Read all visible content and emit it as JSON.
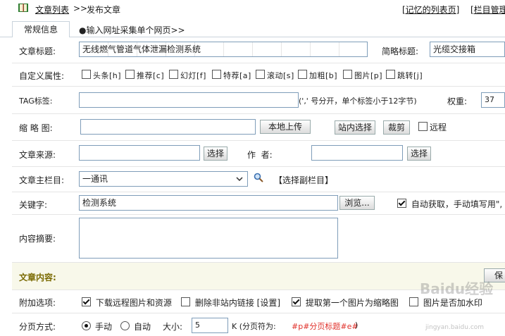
{
  "header": {
    "breadcrumb_link": "文章列表",
    "breadcrumb_sep": ">>",
    "breadcrumb_current": "发布文章",
    "link_saved": "[记忆的列表页]",
    "link_column": "[栏目管理"
  },
  "tabs": {
    "general": "常规信息",
    "url_collect": "●输入网址采集单个网页>>"
  },
  "title_row": {
    "label": "文章标题:",
    "value": "无线燃气管道气体泄漏检测系统",
    "short_label": "简略标题:",
    "short_value": "光缆交接箱"
  },
  "attrs_row": {
    "label": "自定义属性:",
    "items": [
      {
        "label": "头条[h]",
        "checked": false
      },
      {
        "label": "推荐[c]",
        "checked": false
      },
      {
        "label": "幻灯[f]",
        "checked": false
      },
      {
        "label": "特荐[a]",
        "checked": false
      },
      {
        "label": "滚动[s]",
        "checked": false
      },
      {
        "label": "加粗[b]",
        "checked": false
      },
      {
        "label": "图片[p]",
        "checked": false
      },
      {
        "label": "跳转[j]",
        "checked": false
      }
    ]
  },
  "tag_row": {
    "label": "TAG标签:",
    "value": "",
    "hint": "(',' 号分开，单个标签小于12字节)",
    "weight_label": "权重:",
    "weight_value": "37"
  },
  "thumb_row": {
    "label": "缩 略 图:",
    "value": "",
    "upload_btn": "本地上传",
    "site_btn": "站内选择",
    "crop_btn": "裁剪",
    "remote_label": "远程"
  },
  "source_row": {
    "label": "文章来源:",
    "value": "",
    "select_btn": "选择",
    "author_label": "作  者:",
    "author_value": "",
    "author_btn": "选择"
  },
  "column_row": {
    "label": "文章主栏目:",
    "selected": "一通讯",
    "sub_link": "【选择副栏目】",
    "icon": "magnifier-icon"
  },
  "keyword_row": {
    "label": "关键字:",
    "value": "检测系统",
    "browse_btn": "浏览...",
    "auto_label": "自动获取，手动填写用\","
  },
  "summary_row": {
    "label": "内容摘要:",
    "value": ""
  },
  "content_row": {
    "label": "文章内容:",
    "save_btn": "保"
  },
  "extra_row": {
    "label": "附加选项:",
    "items": [
      {
        "label": "下载远程图片和资源",
        "checked": true
      },
      {
        "label": "删除非站内链接 [设置]",
        "checked": false
      },
      {
        "label": "提取第一个图片为缩略图",
        "checked": true
      },
      {
        "label": "图片是否加水印",
        "checked": false
      }
    ]
  },
  "page_row": {
    "label": "分页方式:",
    "manual": "手动",
    "auto": "自动",
    "size_label": "大小:",
    "size_value": "5",
    "unit": "K (分页符为:",
    "separator": "#p#分页标题#e#",
    "close": ")"
  },
  "watermark": {
    "text": "Baidu经验",
    "sub": "jingyan.baidu.com"
  }
}
